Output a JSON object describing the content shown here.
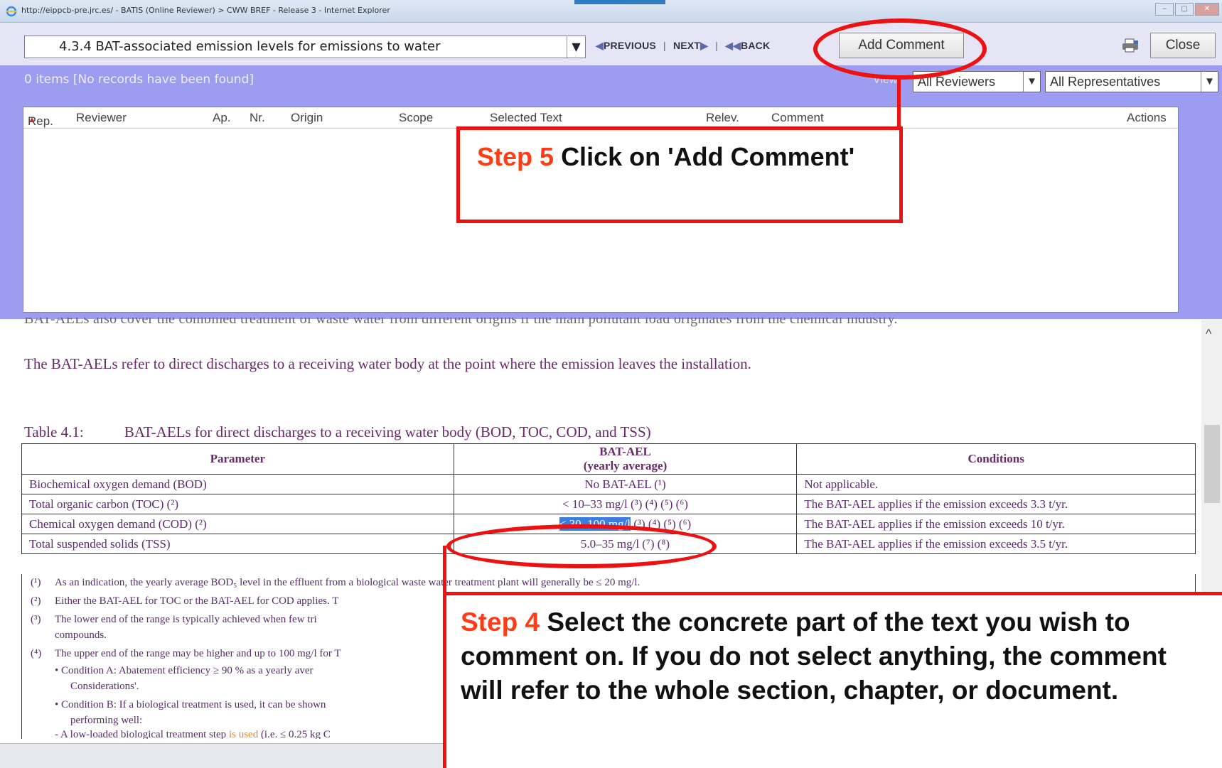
{
  "window": {
    "title": "http://eippcb-pre.jrc.es/ - BATIS (Online Reviewer) > CWW BREF - Release 3 - Internet Explorer",
    "controls": [
      "–",
      "▢",
      "✕"
    ]
  },
  "toolbar": {
    "section_value": "4.3.4  BAT-associated emission levels for emissions to water",
    "section_dropdown": "▼",
    "nav_previous": "PREVIOUS",
    "nav_next": "NEXT",
    "nav_back": "BACK",
    "nav_sep": "|",
    "add_comment": "Add Comment",
    "close": "Close"
  },
  "panel": {
    "items_count": "0 items [No records have been found]",
    "view_label": "View:",
    "filter_reviewers": "All Reviewers",
    "filter_representatives": "All Representatives",
    "dropdown_glyph": "▼",
    "columns": [
      "Rep.",
      "Reviewer",
      "Ap.",
      "Nr.",
      "Origin",
      "Scope",
      "Selected Text",
      "Relev.",
      "Comment",
      "Actions"
    ],
    "sort_glyph": "▲"
  },
  "document": {
    "cut_line": "BAT-AELs also cover the combined treatment of waste water from different origins if the main pollutant load originates from the chemical industry.",
    "paragraph": "The BAT-AELs refer to direct discharges to a receiving water body at the point where the emission leaves the installation.",
    "table_label": "Table 4.1:",
    "table_title": "BAT-AELs for direct discharges to a receiving water body (BOD, TOC, COD, and TSS)",
    "table": {
      "headers": [
        "Parameter",
        "BAT-AEL",
        "(yearly average)",
        "Conditions"
      ],
      "rows": [
        {
          "parameter": "Biochemical oxygen demand (BOD)",
          "bat_ael": "No BAT-AEL (¹)",
          "selected": "",
          "condition": "Not applicable."
        },
        {
          "parameter": "Total organic carbon (TOC) (²)",
          "bat_ael": "< 10–33 mg/l (³) (⁴) (⁵) (⁶)",
          "selected": "",
          "condition": "The BAT-AEL applies if the emission exceeds 3.3 t/yr."
        },
        {
          "parameter": "Chemical oxygen demand (COD) (²)",
          "bat_ael": " (³) (⁴) (⁵) (⁶)",
          "selected": "< 30–100 mg/l",
          "condition": "The BAT-AEL applies if the emission exceeds 10 t/yr."
        },
        {
          "parameter": "Total suspended solids (TSS)",
          "bat_ael": "5.0–35 mg/l (⁷) (⁸)",
          "selected": "",
          "condition": "The BAT-AEL applies if the emission exceeds 3.5 t/yr."
        }
      ]
    },
    "footnotes": [
      {
        "n": "(¹)",
        "text": "As an indication, the yearly average BOD₅ level in the effluent from a biological waste water treatment plant will generally be ≤ 20 mg/l."
      },
      {
        "n": "(²)",
        "text": "Either the BAT-AEL for TOC or the BAT-AEL for COD applies. T"
      },
      {
        "n": "(³)",
        "text": "The lower end of the range is typically achieved when few tri"
      },
      {
        "n": "",
        "text": "compounds."
      },
      {
        "n": "(⁴)",
        "text": "The upper end of the range may be higher and up to 100 mg/l for T"
      },
      {
        "n": "",
        "text": "•  Condition A: Abatement efficiency ≥ 90 % as a yearly aver"
      },
      {
        "n": "",
        "text": "Considerations'."
      },
      {
        "n": "",
        "text": "•  Condition B: If a biological treatment is used, it can be shown"
      },
      {
        "n": "",
        "text": "performing well:"
      },
      {
        "n": "",
        "text_before": "- A low-loaded biological treatment step ",
        "text_orange": "is used",
        "text_after": " (i.e. ≤ 0.25 kg C"
      }
    ]
  },
  "annotations": {
    "step5_label": "Step 5",
    "step5_text": "Click on 'Add Comment'",
    "step4_label": "Step 4",
    "step4_text": "Select the concrete part of the text you wish to comment on. If you do not select anything, the comment will refer to the whole section, chapter, or document."
  },
  "colors": {
    "panel": "#9c9cf0",
    "annotation_red": "#e11111",
    "step_orange": "#ff3c14",
    "selection_blue": "#3a7ce0"
  }
}
